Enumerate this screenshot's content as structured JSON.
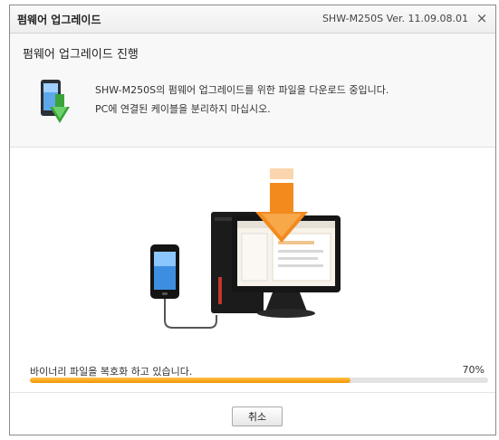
{
  "window": {
    "title": "펌웨어 업그레이드",
    "version": "SHW-M250S Ver. 11.09.08.01",
    "close_glyph": "×"
  },
  "header": {
    "heading": "펌웨어 업그레이드 진행",
    "message_line1": "SHW-M250S의 펌웨어 업그레이드를 위한 파일을 다운로드 중입니다.",
    "message_line2": "PC에 연결된 케이블을 분리하지 마십시오.",
    "icon": "phone-download-icon"
  },
  "illustration": {
    "icons": [
      "phone-icon",
      "monitor-icon",
      "pc-tower-icon",
      "download-arrow-icon",
      "usb-cable-icon"
    ]
  },
  "progress": {
    "status_text": "바이너리 파일을 복호화 하고 있습니다.",
    "percent_text": "70%",
    "value": 0.7,
    "fill_color": "#f29400"
  },
  "footer": {
    "cancel_label": "취소"
  }
}
